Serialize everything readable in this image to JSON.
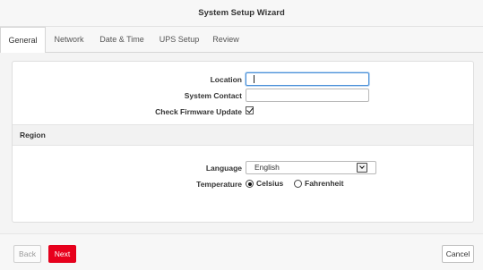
{
  "window": {
    "title": "System Setup Wizard"
  },
  "tabs": [
    {
      "label": "General",
      "active": true
    },
    {
      "label": "Network",
      "active": false
    },
    {
      "label": "Date & Time",
      "active": false
    },
    {
      "label": "UPS Setup",
      "active": false
    },
    {
      "label": "Review",
      "active": false
    }
  ],
  "general": {
    "location": {
      "label": "Location",
      "value": "",
      "placeholder": ""
    },
    "system_contact": {
      "label": "System Contact",
      "value": "",
      "placeholder": ""
    },
    "check_firmware_update": {
      "label": "Check Firmware Update",
      "checked": true
    }
  },
  "region": {
    "section_title": "Region",
    "language": {
      "label": "Language",
      "selected": "English"
    },
    "temperature": {
      "label": "Temperature",
      "options": [
        {
          "label": "Celsius",
          "selected": true
        },
        {
          "label": "Fahrenheit",
          "selected": false
        }
      ]
    }
  },
  "footer": {
    "back_label": "Back",
    "next_label": "Next",
    "cancel_label": "Cancel"
  },
  "colors": {
    "accent": "#e8001c",
    "focus": "#4a90d9"
  },
  "icons": {
    "checkbox": "checkmark-icon",
    "select": "chevron-down-icon",
    "radio": "radio-dot-icon"
  }
}
